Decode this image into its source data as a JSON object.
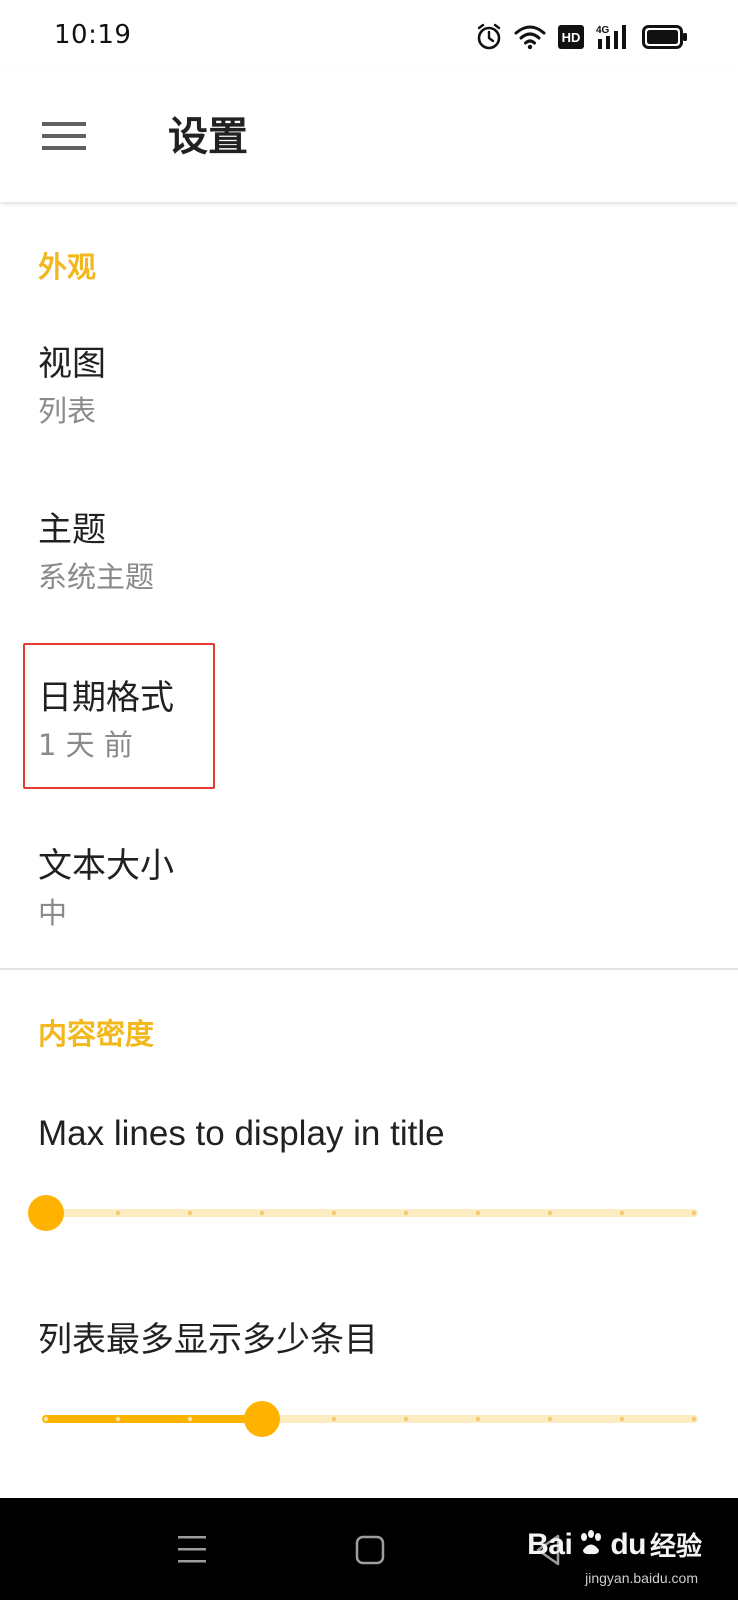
{
  "status_bar": {
    "time": "10:19",
    "icons": [
      "alarm-icon",
      "wifi-icon",
      "hd-icon",
      "signal-4g-icon",
      "battery-icon"
    ],
    "hd_label": "HD",
    "network_label": "4G"
  },
  "app_bar": {
    "title": "设置",
    "menu_icon": "hamburger-menu-icon"
  },
  "sections": {
    "appearance": {
      "header": "外观",
      "items": [
        {
          "title": "视图",
          "summary": "列表"
        },
        {
          "title": "主题",
          "summary": "系统主题"
        },
        {
          "title": "日期格式",
          "summary": "1 天 前"
        },
        {
          "title": "文本大小",
          "summary": "中"
        }
      ]
    },
    "content_density": {
      "header": "内容密度",
      "sliders": [
        {
          "title": "Max lines to display in title",
          "steps": 10,
          "value_index": 0
        },
        {
          "title": "列表最多显示多少条目",
          "steps": 10,
          "value_index": 3
        }
      ]
    }
  },
  "colors": {
    "accent": "#F2B81C",
    "slider_active": "#FFB300",
    "slider_track": "#FDEBC1",
    "highlight": "#e53935"
  },
  "nav_bar": {
    "buttons": [
      "recents-menu-icon",
      "home-square-icon",
      "back-triangle-icon"
    ]
  },
  "watermark": {
    "brand": "Bai",
    "brand_suffix": "du",
    "cn": "经验",
    "url": "jingyan.baidu.com"
  }
}
